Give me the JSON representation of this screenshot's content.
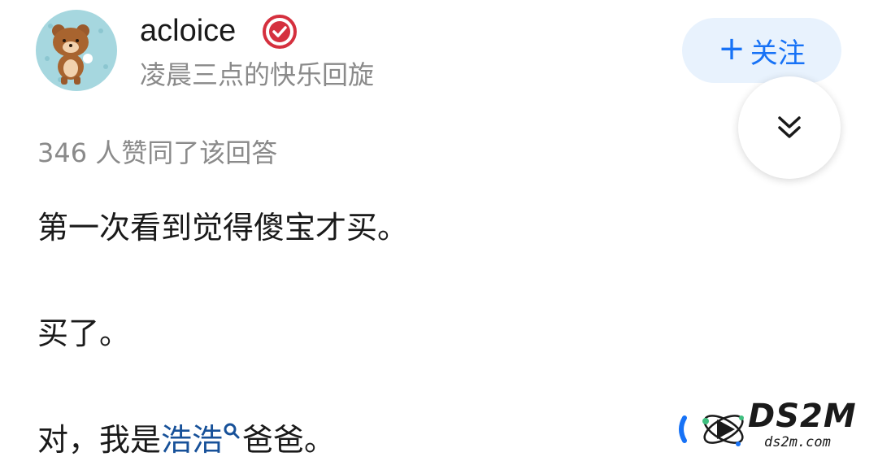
{
  "author": {
    "name": "acloice",
    "bio": "凌晨三点的快乐回旋",
    "avatar_icon": "bear-avatar",
    "badge_icon": "verified-badge-icon"
  },
  "actions": {
    "follow_plus": "+",
    "follow_label": "关注",
    "collapse_icon": "double-chevron-down-icon"
  },
  "answer": {
    "vote_text": "346 人赞同了该回答",
    "paragraphs": {
      "p1": "第一次看到觉得傻宝才买。",
      "p2": "买了。",
      "p3_before": "对，我是",
      "p3_link": "浩浩",
      "p3_after": "爸爸。"
    }
  },
  "watermark": {
    "brand": "DS2M",
    "domain": "ds2m.com"
  },
  "colors": {
    "accent": "#1772f6",
    "link": "#175199",
    "follow_bg": "#e8f2fd",
    "muted": "#8a8a8a",
    "avatar_bg": "#a6d7df"
  }
}
